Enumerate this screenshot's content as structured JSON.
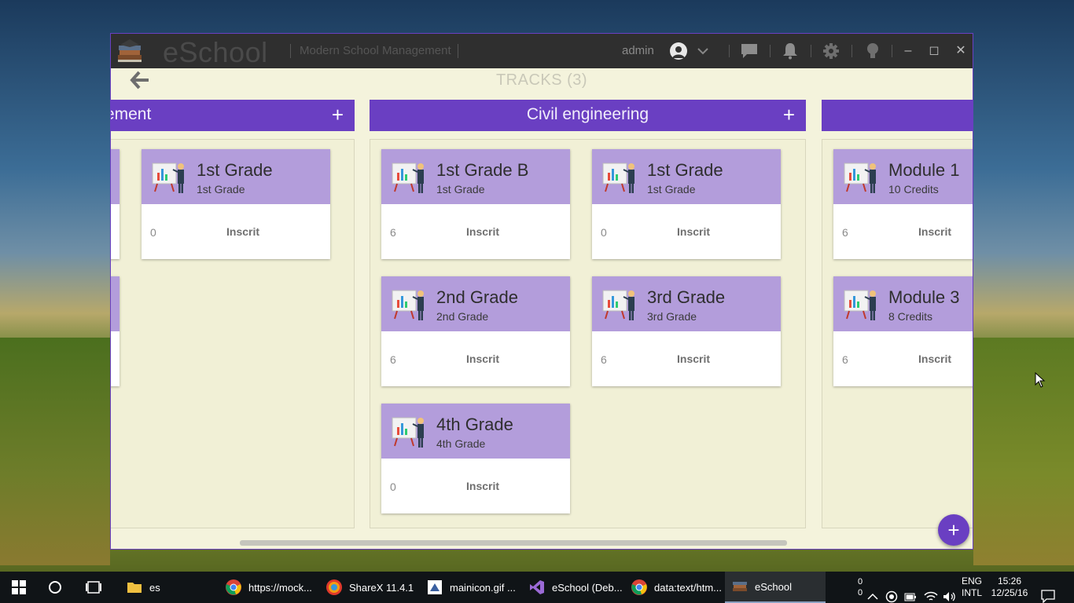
{
  "window": {
    "app_name": "eSchool",
    "tagline": "Modern School Management",
    "user": "admin"
  },
  "page": {
    "title": "TRACKS (3)"
  },
  "columns": [
    {
      "title": "Management",
      "cards": [
        {
          "title": "1st Grade",
          "subtitle": "1st Grade",
          "count": "0",
          "status": "Inscrit"
        }
      ]
    },
    {
      "title": "Civil engineering",
      "cards": [
        {
          "title": "1st Grade B",
          "subtitle": "1st Grade",
          "count": "6",
          "status": "Inscrit"
        },
        {
          "title": "1st Grade",
          "subtitle": "1st Grade",
          "count": "0",
          "status": "Inscrit"
        },
        {
          "title": "2nd Grade",
          "subtitle": "2nd Grade",
          "count": "6",
          "status": "Inscrit"
        },
        {
          "title": "3rd Grade",
          "subtitle": "3rd Grade",
          "count": "6",
          "status": "Inscrit"
        },
        {
          "title": "4th Grade",
          "subtitle": "4th Grade",
          "count": "0",
          "status": "Inscrit"
        }
      ]
    },
    {
      "title": "",
      "cards": [
        {
          "title": "Module 1",
          "subtitle": "10 Credits",
          "count": "6",
          "status": "Inscrit"
        },
        {
          "title": "Module 3",
          "subtitle": "8 Credits",
          "count": "6",
          "status": "Inscrit"
        }
      ]
    }
  ],
  "add_button": "+",
  "taskbar": {
    "apps": [
      {
        "label": "es",
        "icon": "folder-icon"
      },
      {
        "label": "https://mock...",
        "icon": "chrome-icon"
      },
      {
        "label": "ShareX 11.4.1",
        "icon": "sharex-icon"
      },
      {
        "label": "mainicon.gif ...",
        "icon": "image-editor-icon"
      },
      {
        "label": "eSchool (Deb...",
        "icon": "visual-studio-icon"
      },
      {
        "label": "data:text/htm...",
        "icon": "chrome-icon"
      },
      {
        "label": "eSchool",
        "icon": "eschool-icon"
      }
    ],
    "network_counts": [
      "0",
      "0"
    ],
    "language": "ENG",
    "layout": "INTL",
    "time": "15:26",
    "date": "12/25/16"
  },
  "colors": {
    "accent": "#6a3fc2",
    "card_header": "#b39ddb",
    "window_bg": "#f4f3dc"
  }
}
